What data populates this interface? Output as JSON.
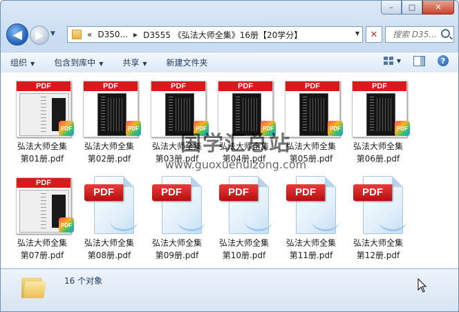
{
  "window": {
    "minimize": "–",
    "maximize": "□",
    "close": "✕"
  },
  "nav": {
    "back": "◀",
    "forward": "▶",
    "history": "▼",
    "breadcrumb_overflow": "«",
    "breadcrumb_1": "D350...",
    "breadcrumb_sep": "▶",
    "breadcrumb_2": "D3555 《弘法大师全集》16册【20学分】",
    "address_dropdown": "▼",
    "refresh": "✕",
    "search_placeholder": "搜索 D35..."
  },
  "toolbar": {
    "organize": "组织",
    "include_library": "包含到库中",
    "share": "共享",
    "new_folder": "新建文件夹",
    "arrow": "▼"
  },
  "files": [
    {
      "line1": "弘法大师全集",
      "line2": "第01册.pdf",
      "kind": "scan"
    },
    {
      "line1": "弘法大师全集",
      "line2": "第02册.pdf",
      "kind": "scan"
    },
    {
      "line1": "弘法大师全集",
      "line2": "第03册.pdf",
      "kind": "scan"
    },
    {
      "line1": "弘法大师全集",
      "line2": "第04册.pdf",
      "kind": "scan"
    },
    {
      "line1": "弘法大师全集",
      "line2": "第05册.pdf",
      "kind": "scan"
    },
    {
      "line1": "弘法大师全集",
      "line2": "第06册.pdf",
      "kind": "scan"
    },
    {
      "line1": "弘法大师全集",
      "line2": "第07册.pdf",
      "kind": "scan"
    },
    {
      "line1": "弘法大师全集",
      "line2": "第08册.pdf",
      "kind": "icon"
    },
    {
      "line1": "弘法大师全集",
      "line2": "第09册.pdf",
      "kind": "icon"
    },
    {
      "line1": "弘法大师全集",
      "line2": "第10册.pdf",
      "kind": "icon"
    },
    {
      "line1": "弘法大师全集",
      "line2": "第11册.pdf",
      "kind": "icon"
    },
    {
      "line1": "弘法大师全集",
      "line2": "第12册.pdf",
      "kind": "icon"
    }
  ],
  "thumb_band": "PDF",
  "badge": "PDF",
  "icon_label": "PDF",
  "help": "?",
  "watermark": {
    "cn": "国学汇总站",
    "url": "www.guoxuehuizong.com"
  },
  "status": {
    "count": "16 个对象"
  }
}
